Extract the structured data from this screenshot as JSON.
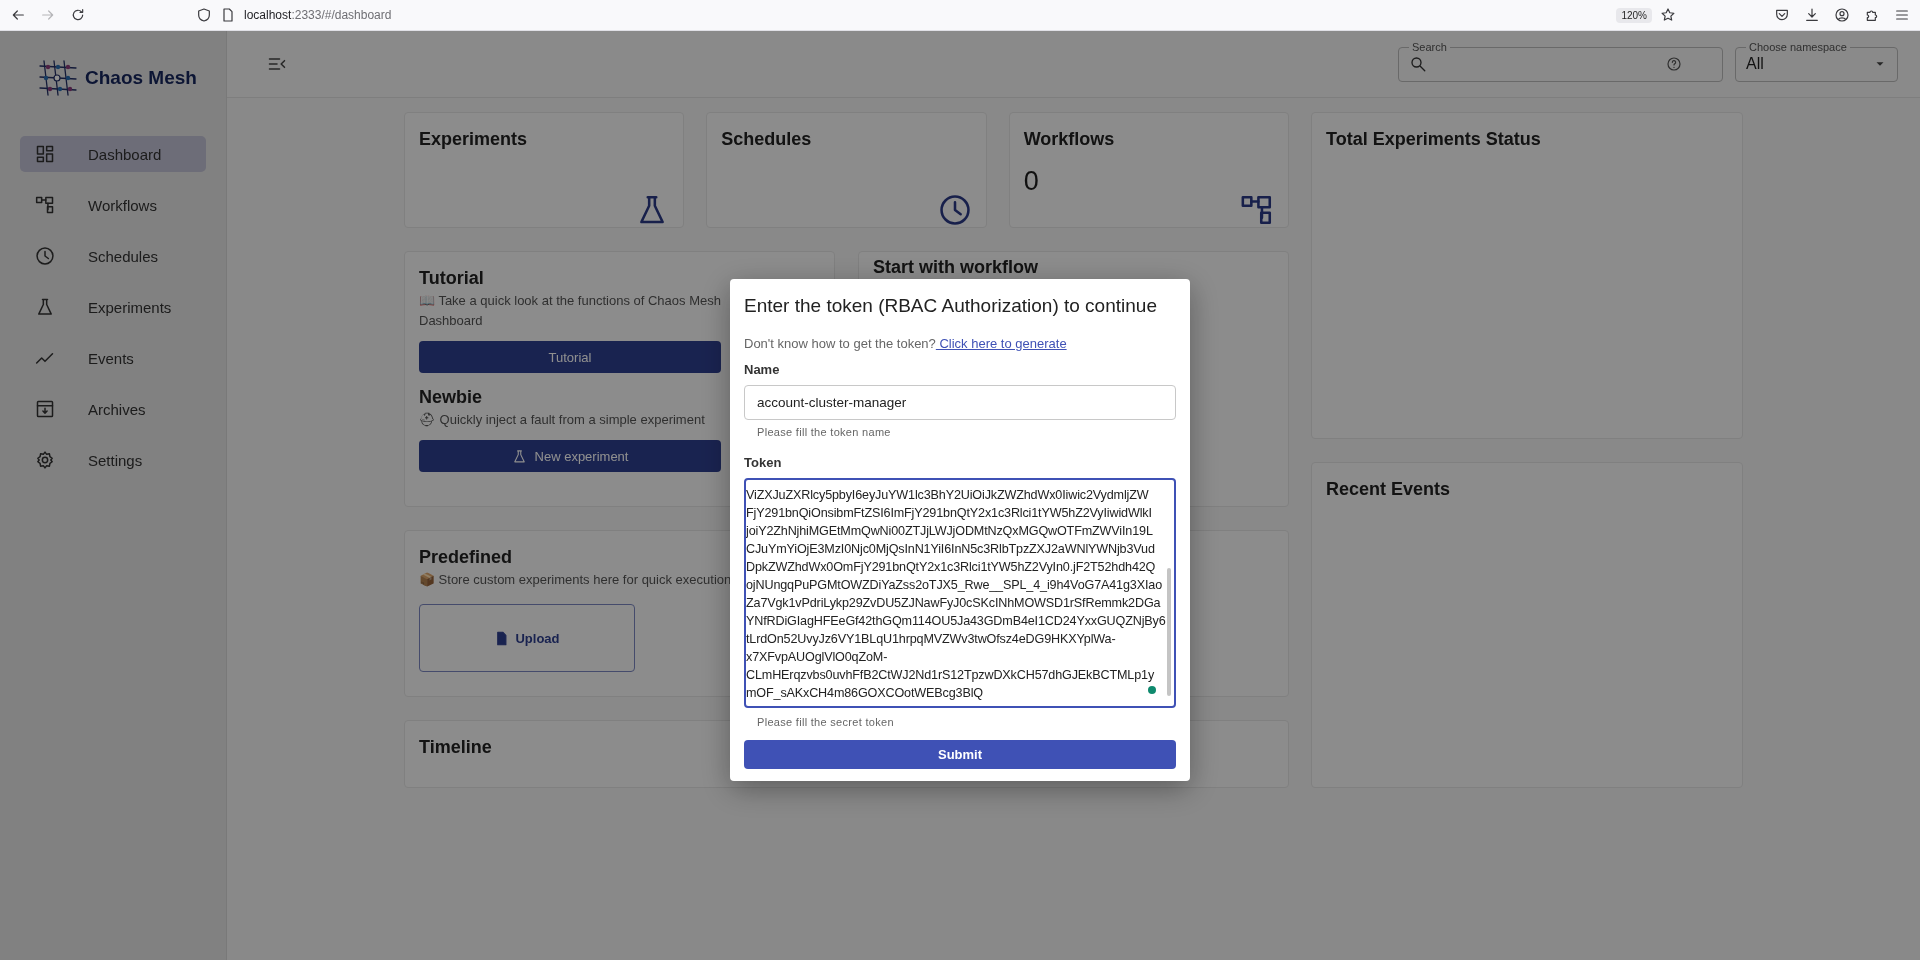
{
  "browser": {
    "url_host": "localhost",
    "url_path": ":2333/#/dashboard",
    "zoom": "120%"
  },
  "sidebar": {
    "logo_text": "Chaos Mesh",
    "items": [
      {
        "label": "Dashboard",
        "selected": true
      },
      {
        "label": "Workflows",
        "selected": false
      },
      {
        "label": "Schedules",
        "selected": false
      },
      {
        "label": "Experiments",
        "selected": false
      },
      {
        "label": "Events",
        "selected": false
      },
      {
        "label": "Archives",
        "selected": false
      },
      {
        "label": "Settings",
        "selected": false
      }
    ]
  },
  "header": {
    "search": {
      "label": "Search"
    },
    "namespace": {
      "label": "Choose namespace",
      "value": "All"
    }
  },
  "stat_cards": [
    {
      "title": "Experiments"
    },
    {
      "title": "Schedules"
    },
    {
      "title": "Workflows",
      "value": "0"
    }
  ],
  "tutorial": {
    "title": "Tutorial",
    "text": "📖 Take a quick look at the functions of Chaos Mesh Dashboard",
    "button": "Tutorial",
    "newbie_title": "Newbie",
    "newbie_text": "⛑ Quickly inject a fault from a simple experiment",
    "newbie_button": "New experiment"
  },
  "workflow_card": {
    "title": "Start with workflow"
  },
  "predefined": {
    "title": "Predefined",
    "text": "📦 Store custom experiments here for quick execution",
    "upload": "Upload"
  },
  "timeline": {
    "title": "Timeline"
  },
  "status_card": {
    "title": "Total Experiments Status"
  },
  "events_card": {
    "title": "Recent Events"
  },
  "dialog": {
    "title": "Enter the token (RBAC Authorization) to continue",
    "hint": "Don't know how to get the token?",
    "link": "Click here to generate",
    "name_label": "Name",
    "name_value": "account-cluster-manager",
    "name_helper": "Please fill the token name",
    "token_label": "Token",
    "token_lines": [
      "ViZXJuZXRlcy5pbyI6eyJuYW1lc3BhY2UiOiJkZWZhdWx0Iiwic2VydmljZW",
      "FjY291bnQiOnsibmFtZSI6ImFjY291bnQtY2x1c3Rlci1tYW5hZ2VyIiwidWlkI",
      "joiY2ZhNjhiMGEtMmQwNi00ZTJjLWJjODMtNzQxMGQwOTFmZWViIn19L",
      "CJuYmYiOjE3MzI0Njc0MjQsInN1YiI6InN5c3RlbTpzZXJ2aWNlYWNjb3Vud",
      "DpkZWZhdWx0OmFjY291bnQtY2x1c3Rlci1tYW5hZ2VyIn0.jF2T52hdh42Q",
      "ojNUngqPuPGMtOWZDiYaZss2oTJX5_Rwe__SPL_4_i9h4VoG7A41g3XIao",
      "Za7Vgk1vPdriLykp29ZvDU5ZJNawFyJ0cSKcINhMOWSD1rSfRemmk2DGa",
      "YNfRDiGIagHFEeGf42thGQm114OU5Ja43GDmB4eI1CD24YxxGUQZNjBy6",
      "tLrdOn52UvyJz6VY1BLqU1hrpqMVZWv3twOfsz4eDG9HKXYplWa-",
      "x7XFvpAUOglVlO0qZoM-",
      "CLmHErqzvbs0uvhFfB2CtWJ2Nd1rS12TpzwDXkCH57dhGJEkBCTMLp1y",
      "mOF_sAKxCH4m86GOXCOotWEBcg3BlQ"
    ],
    "token_helper": "Please fill the secret token",
    "submit": "Submit"
  }
}
